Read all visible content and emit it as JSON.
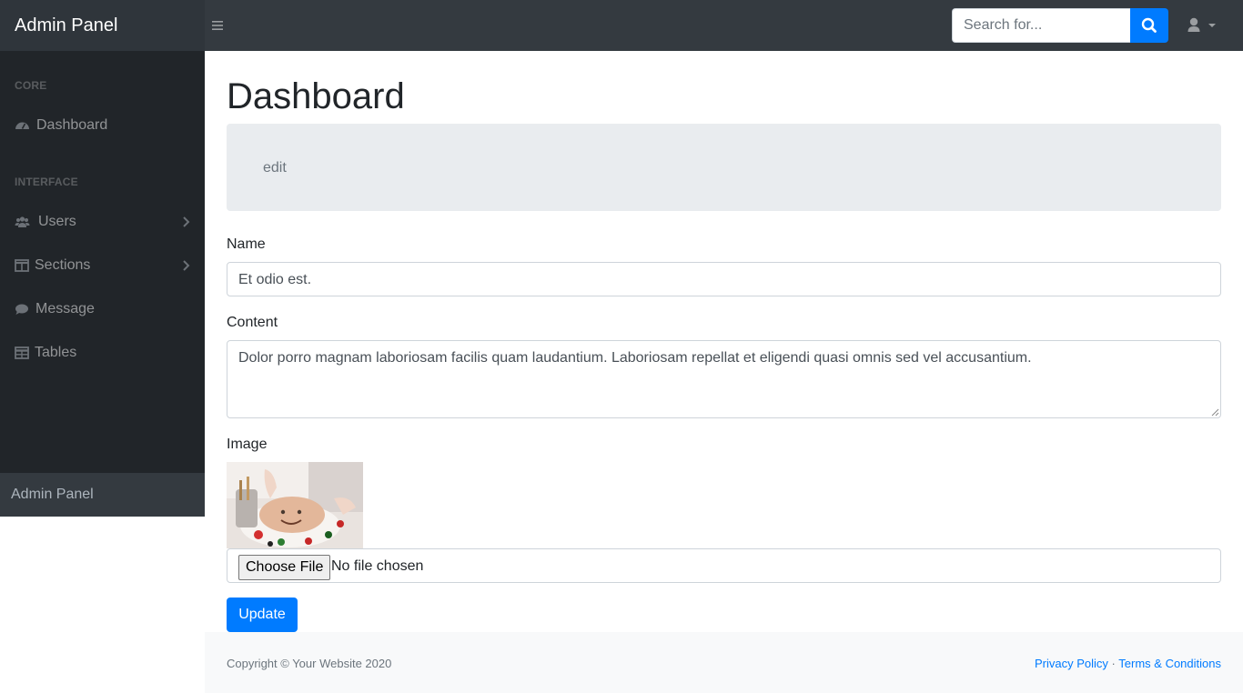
{
  "navbar": {
    "brand": "Admin Panel",
    "toggle_icon": "bars-icon",
    "search": {
      "placeholder": "Search for...",
      "value": ""
    },
    "search_button_icon": "search-icon",
    "user_icon": "user-icon",
    "accent_color": "#007bff"
  },
  "sidebar": {
    "sections": [
      {
        "heading": "CORE"
      },
      {
        "heading": "INTERFACE"
      }
    ],
    "items": [
      {
        "label": "Dashboard",
        "icon": "tachometer-icon"
      },
      {
        "label": "Users",
        "icon": "users-icon",
        "has_submenu": true
      },
      {
        "label": "Sections",
        "icon": "columns-icon",
        "has_submenu": true
      },
      {
        "label": "Message",
        "icon": "comment-icon"
      },
      {
        "label": "Tables",
        "icon": "table-icon"
      }
    ],
    "footer_text": "Admin Panel"
  },
  "main": {
    "title": "Dashboard",
    "breadcrumb": "edit",
    "form": {
      "name_label": "Name",
      "name_value": "Et odio est.",
      "content_label": "Content",
      "content_value": "Dolor porro magnam laboriosam facilis quam laudantium. Laboriosam repellat et eligendi quasi omnis sed vel accusantium.",
      "image_label": "Image",
      "file_button": "Choose File",
      "file_status": "No file chosen",
      "submit_label": "Update"
    }
  },
  "footer": {
    "copyright": "Copyright © Your Website 2020",
    "privacy": "Privacy Policy",
    "separator": "·",
    "terms": "Terms & Conditions"
  }
}
